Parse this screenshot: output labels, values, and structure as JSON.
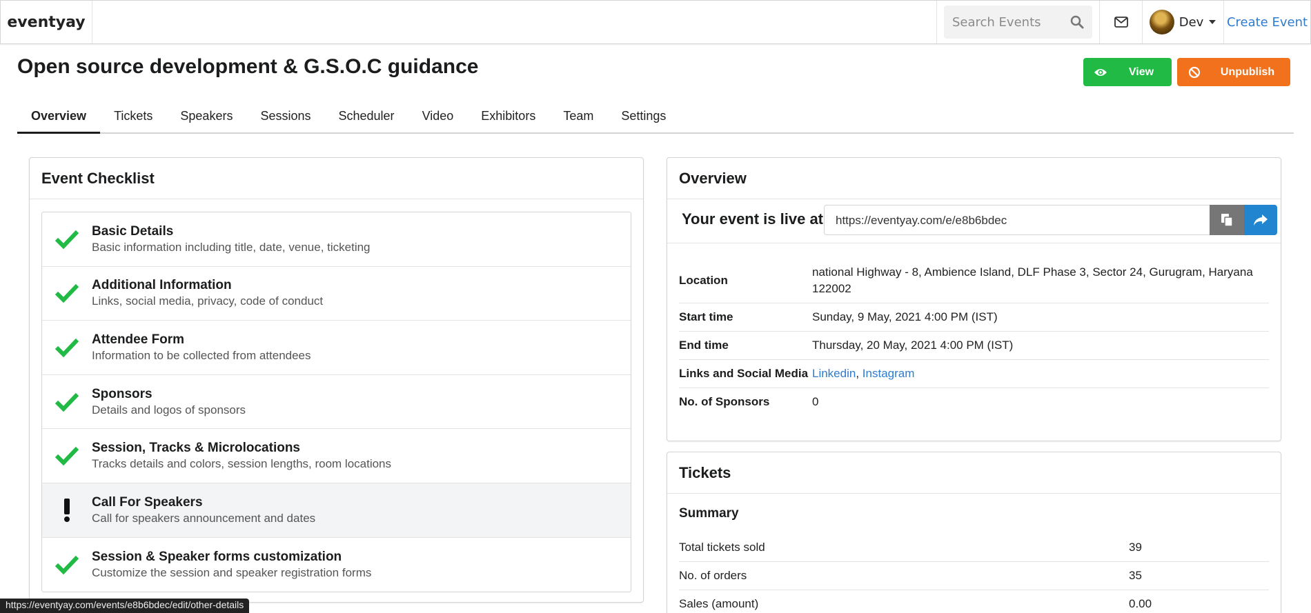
{
  "navbar": {
    "brand": "eventyay",
    "search_placeholder": "Search Events",
    "user_name": "Dev",
    "create_event": "Create Event"
  },
  "header": {
    "title": "Open source development & G.S.O.C guidance",
    "view_label": "View",
    "unpublish_label": "Unpublish"
  },
  "tabs": [
    "Overview",
    "Tickets",
    "Speakers",
    "Sessions",
    "Scheduler",
    "Video",
    "Exhibitors",
    "Team",
    "Settings"
  ],
  "checklist": {
    "title": "Event Checklist",
    "items": [
      {
        "title": "Basic Details",
        "desc": "Basic information including title, date, venue, ticketing",
        "status": "done"
      },
      {
        "title": "Additional Information",
        "desc": "Links, social media, privacy, code of conduct",
        "status": "done"
      },
      {
        "title": "Attendee Form",
        "desc": "Information to be collected from attendees",
        "status": "done"
      },
      {
        "title": "Sponsors",
        "desc": "Details and logos of sponsors",
        "status": "done"
      },
      {
        "title": "Session, Tracks & Microlocations",
        "desc": "Tracks details and colors, session lengths, room locations",
        "status": "done"
      },
      {
        "title": "Call For Speakers",
        "desc": "Call for speakers announcement and dates",
        "status": "warning"
      },
      {
        "title": "Session & Speaker forms customization",
        "desc": "Customize the session and speaker registration forms",
        "status": "done"
      }
    ]
  },
  "overview": {
    "title": "Overview",
    "live_label": "Your event is live at",
    "url": "https://eventyay.com/e/e8b6bdec",
    "rows": {
      "location_key": "Location",
      "location_val": "national Highway - 8, Ambience Island, DLF Phase 3, Sector 24, Gurugram, Haryana 122002",
      "start_key": "Start time",
      "start_val": "Sunday, 9 May, 2021 4:00 PM (IST)",
      "end_key": "End time",
      "end_val": "Thursday, 20 May, 2021 4:00 PM (IST)",
      "links_key": "Links and Social Media",
      "link1": "Linkedin",
      "link_sep": ",",
      "link2": "Instagram",
      "sponsors_key": "No. of Sponsors",
      "sponsors_val": "0"
    }
  },
  "tickets": {
    "title": "Tickets",
    "summary": "Summary",
    "rows": [
      {
        "label": "Total tickets sold",
        "value": "39"
      },
      {
        "label": "No. of orders",
        "value": "35"
      },
      {
        "label": "Sales (amount)",
        "value": "0.00"
      }
    ]
  },
  "status_bar_url": "https://eventyay.com/events/e8b6bdec/edit/other-details",
  "colors": {
    "success": "#21ba45",
    "warning": "#f2711c",
    "link": "#2e7bcf",
    "share": "#2185d0",
    "copy": "#767676"
  }
}
